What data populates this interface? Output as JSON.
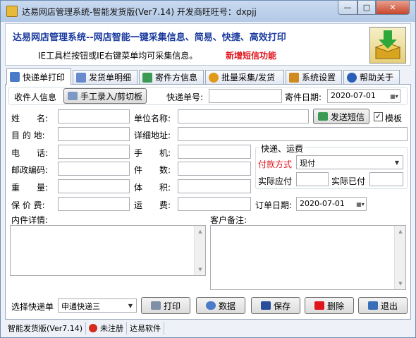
{
  "window": {
    "title": "达易网店管理系统-智能发货版(Ver7.14) 开发商旺旺号：dxpjj",
    "min": "—",
    "max": "□",
    "close": "✕"
  },
  "banner": {
    "line1": "达易网店管理系统--网店智能一键采集信息、简易、快捷、高效打印",
    "line2": "IE工具栏按钮或IE右键菜单均可采集信息。",
    "line3": "新增短信功能"
  },
  "tabs": [
    {
      "label": "快递单打印",
      "icon": "printer-icon",
      "color": "#4a7bc8"
    },
    {
      "label": "发货单明细",
      "icon": "document-icon",
      "color": "#6a8ad0"
    },
    {
      "label": "寄件方信息",
      "icon": "sender-icon",
      "color": "#3c9a54"
    },
    {
      "label": "批量采集/发货",
      "icon": "batch-icon",
      "color": "#e09a18"
    },
    {
      "label": "系统设置",
      "icon": "settings-icon",
      "color": "#d08a20"
    },
    {
      "label": "帮助关于",
      "icon": "help-icon",
      "color": "#2a5fb8"
    }
  ],
  "form": {
    "recipient_info": "收件人信息",
    "manual_entry": "手工录入/剪切板",
    "tracking_no": "快递单号:",
    "send_date_label": "寄件日期:",
    "send_date": "2020-07-01",
    "name": "姓　　名:",
    "company": "单位名称:",
    "send_sms": "发送短信",
    "template": "模板",
    "template_checked": "✓",
    "destination": "目 的 地:",
    "address": "详细地址:",
    "phone": "电　　话:",
    "mobile": "手　　机:",
    "postcode": "邮政编码:",
    "pieces": "件　　数:",
    "weight": "重　　量:",
    "volume": "体　　积:",
    "insured": "保 价 费:",
    "freight": "运　　费:",
    "order_date_label": "订单日期:",
    "order_date": "2020-07-01",
    "contents": "内件详情:",
    "remark": "客户备注:",
    "shipping_group": "快递、运费",
    "pay_method": "付款方式",
    "pay_value": "现付",
    "actual_due": "实际应付",
    "actual_paid": "实际已付"
  },
  "toolbar": {
    "select_courier": "选择快递单",
    "courier": "申通快递三",
    "print": "打印",
    "data": "数据",
    "save": "保存",
    "delete": "删除",
    "exit": "退出"
  },
  "status": {
    "version": "智能发货版(Ver7.14)",
    "reg": "未注册",
    "vendor": "达易软件"
  },
  "colors": {
    "accent": "#1a3a9e",
    "red": "#e0141c",
    "pay": "#e0141c"
  }
}
